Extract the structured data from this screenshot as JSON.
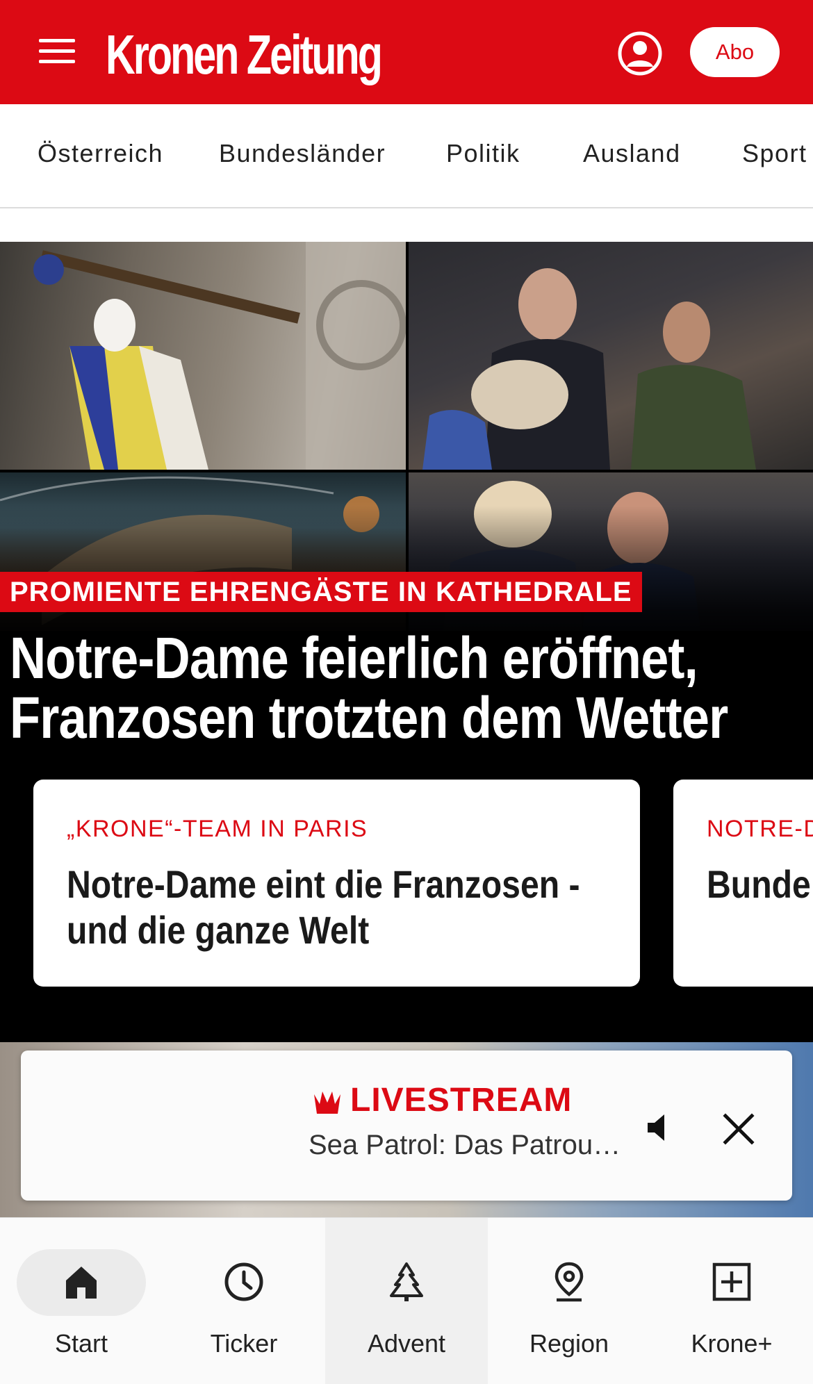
{
  "header": {
    "brand": "Kronen Zeitung",
    "abo_label": "Abo"
  },
  "categories": [
    "Österreich",
    "Bundesländer",
    "Politik",
    "Ausland",
    "Sport"
  ],
  "hero": {
    "kicker": "PROMIENTE EHRENGÄSTE IN KATHEDRALE",
    "headline": "Notre-Dame feierlich eröffnet, Franzosen trotzten dem Wetter"
  },
  "cards": [
    {
      "kicker": "„KRONE“-TEAM IN PARIS",
      "title": "Notre-Dame eint die Franzosen - und die ganze Welt"
    },
    {
      "kicker": "NOTRE-D",
      "title": "Bunde Symbo"
    }
  ],
  "livestream": {
    "label": "LIVESTREAM",
    "title": "Sea Patrol: Das Patrou…"
  },
  "bottom_nav": [
    {
      "label": "Start",
      "icon": "home-icon"
    },
    {
      "label": "Ticker",
      "icon": "clock-icon"
    },
    {
      "label": "Advent",
      "icon": "tree-icon"
    },
    {
      "label": "Region",
      "icon": "location-pin-icon"
    },
    {
      "label": "Krone+",
      "icon": "plus-box-icon"
    }
  ],
  "colors": {
    "brand_red": "#dc0a14",
    "background": "#ffffff",
    "hero_bg": "#000000"
  }
}
